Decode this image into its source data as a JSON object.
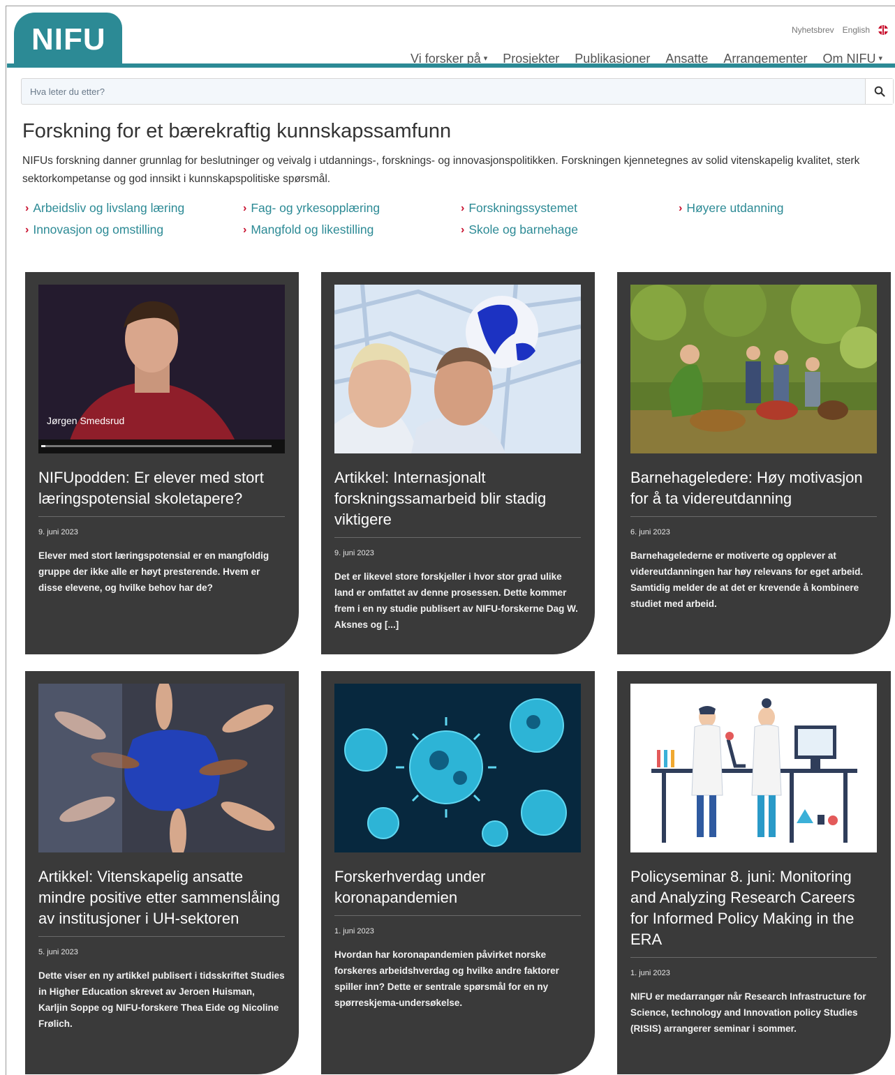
{
  "header": {
    "logo": "NIFU",
    "newsletter": "Nyhetsbrev",
    "language": "English",
    "nav": [
      {
        "label": "Vi forsker på",
        "caret": "▾"
      },
      {
        "label": "Prosjekter"
      },
      {
        "label": "Publikasjoner"
      },
      {
        "label": "Ansatte"
      },
      {
        "label": "Arrangementer"
      },
      {
        "label": "Om NIFU",
        "caret": "▾"
      }
    ]
  },
  "search": {
    "placeholder": "Hva leter du etter?"
  },
  "main": {
    "title": "Forskning for et bærekraftig kunnskapssamfunn",
    "intro": "NIFUs forskning danner grunnlag for beslutninger og veivalg i utdannings-, forsknings- og innovasjonspolitikken. Forskningen kjennetegnes av solid vitenskapelig kvalitet, sterk sektorkompetanse og god innsikt i kunnskapspolitiske spørsmål.",
    "topics": [
      "Arbeidsliv og livslang læring",
      "Fag- og yrkesopplæring",
      "Forskningssystemet",
      "Høyere utdanning",
      "Innovasjon og omstilling",
      "Mangfold og likestilling",
      "Skole og barnehage"
    ]
  },
  "cards": [
    {
      "title": "NIFUpodden: Er elever med stort læringspotensial skoletapere?",
      "date": "9. juni 2023",
      "text": "Elever med stort læringspotensial er en mangfoldig gruppe der ikke alle er høyt presterende. Hvem er disse elevene, og hvilke behov har de?",
      "caption": "Jørgen Smedsrud"
    },
    {
      "title": "Artikkel: Internasjonalt forskningssamarbeid blir stadig viktigere",
      "date": "9. juni 2023",
      "text": "Det er likevel store forskjeller i hvor stor grad ulike land er omfattet av denne prosessen. Dette kommer frem i en ny studie publisert av NIFU-forskerne Dag W. Aksnes og [...]"
    },
    {
      "title": "Barnehageledere: Høy motivasjon for å ta videreutdanning",
      "date": "6. juni 2023",
      "text": "Barnehagelederne er motiverte og opplever at videreutdanningen har høy relevans for eget arbeid. Samtidig melder de at det er krevende å kombinere studiet med arbeid."
    },
    {
      "title": "Artikkel: Vitenskapelig ansatte mindre positive etter sammenslåing av institusjoner i UH-sektoren",
      "date": "5. juni 2023",
      "text": "Dette viser en ny artikkel publisert i tidsskriftet Studies in Higher Education skrevet av Jeroen Huisman, Karljin Soppe og NIFU-forskere Thea Eide og Nicoline Frølich."
    },
    {
      "title": "Forskerhverdag under koronapandemien",
      "date": "1. juni 2023",
      "text": "Hvordan har koronapandemien påvirket norske forskeres arbeidshverdag og hvilke andre faktorer spiller inn? Dette er sentrale spørsmål for en ny spørreskjema-undersøkelse."
    },
    {
      "title": "Policyseminar 8. juni: Monitoring and Analyzing Research Careers for Informed Policy Making in the ERA",
      "date": "1. juni 2023",
      "text": "NIFU er medarrangør når Research Infrastructure for Science, technology and Innovation policy Studies (RISIS) arrangerer seminar i sommer."
    }
  ]
}
